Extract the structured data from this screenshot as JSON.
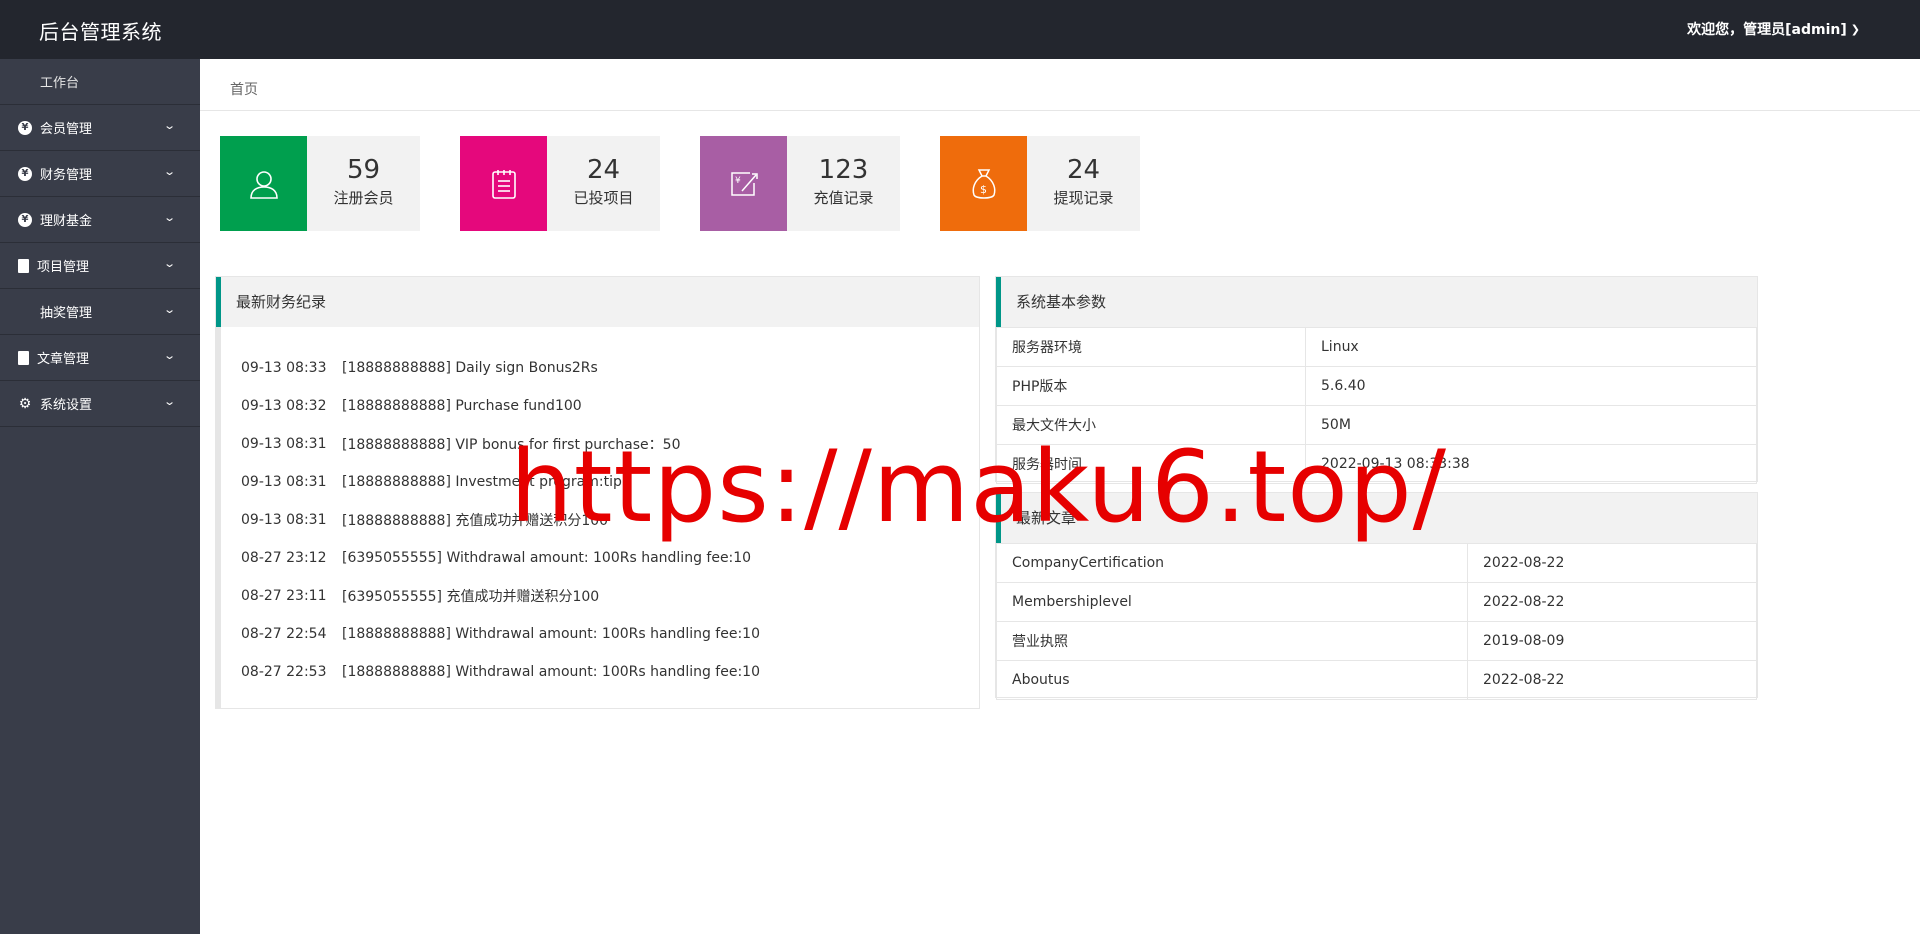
{
  "header": {
    "title": "后台管理系统",
    "user_greeting": "欢迎您，管理员[admin]"
  },
  "sidebar": {
    "items": [
      {
        "label": "工作台",
        "icon": "dashboard-icon"
      },
      {
        "label": "会员管理",
        "icon": "yen-circle-icon"
      },
      {
        "label": "财务管理",
        "icon": "yen-circle-icon"
      },
      {
        "label": "理财基金",
        "icon": "yen-circle-icon"
      },
      {
        "label": "项目管理",
        "icon": "clipboard-icon"
      },
      {
        "label": "抽奖管理",
        "icon": "dashboard-icon"
      },
      {
        "label": "文章管理",
        "icon": "document-icon"
      },
      {
        "label": "系统设置",
        "icon": "gear-icon"
      }
    ]
  },
  "breadcrumb": "首页",
  "stats": [
    {
      "value": "59",
      "label": "注册会员",
      "color": "#009f4e",
      "icon": "user-icon"
    },
    {
      "value": "24",
      "label": "已投项目",
      "color": "#e5087c",
      "icon": "notepad-icon"
    },
    {
      "value": "123",
      "label": "充值记录",
      "color": "#a85ea4",
      "icon": "recharge-icon"
    },
    {
      "value": "24",
      "label": "提现记录",
      "color": "#ef6c0c",
      "icon": "money-bag-icon"
    }
  ],
  "finance_panel": {
    "title": "最新财务纪录",
    "rows": [
      {
        "time": "09-13 08:33",
        "text": "[18888888888] Daily sign Bonus2Rs"
      },
      {
        "time": "09-13 08:32",
        "text": "[18888888888] Purchase fund100"
      },
      {
        "time": "09-13 08:31",
        "text": "[18888888888] VIP bonus for first purchase：50"
      },
      {
        "time": "09-13 08:31",
        "text": "[18888888888] Investment program:tip"
      },
      {
        "time": "09-13 08:31",
        "text": "[18888888888] 充值成功并赠送积分100"
      },
      {
        "time": "08-27 23:12",
        "text": "[6395055555] Withdrawal amount: 100Rs handling fee:10"
      },
      {
        "time": "08-27 23:11",
        "text": "[6395055555] 充值成功并赠送积分100"
      },
      {
        "time": "08-27 22:54",
        "text": "[18888888888] Withdrawal amount: 100Rs handling fee:10"
      },
      {
        "time": "08-27 22:53",
        "text": "[18888888888] Withdrawal amount: 100Rs handling fee:10"
      }
    ]
  },
  "system_panel": {
    "title": "系统基本参数",
    "rows": [
      {
        "key": "服务器环境",
        "value": "Linux"
      },
      {
        "key": "PHP版本",
        "value": "5.6.40"
      },
      {
        "key": "最大文件大小",
        "value": "50M"
      },
      {
        "key": "服务器时间",
        "value": "2022-09-13 08:33:38"
      }
    ]
  },
  "articles_panel": {
    "title": "最新文章",
    "rows": [
      {
        "title": "CompanyCertification",
        "date": "2022-08-22"
      },
      {
        "title": "Membershiplevel",
        "date": "2022-08-22"
      },
      {
        "title": "营业执照",
        "date": "2019-08-09"
      },
      {
        "title": "Aboutus",
        "date": "2022-08-22"
      }
    ]
  },
  "watermark": "https://maku6.top/",
  "colors": {
    "header_bg": "#23262e",
    "sidebar_bg": "#393d49",
    "panel_accent": "#009688",
    "watermark": "#e60000"
  }
}
